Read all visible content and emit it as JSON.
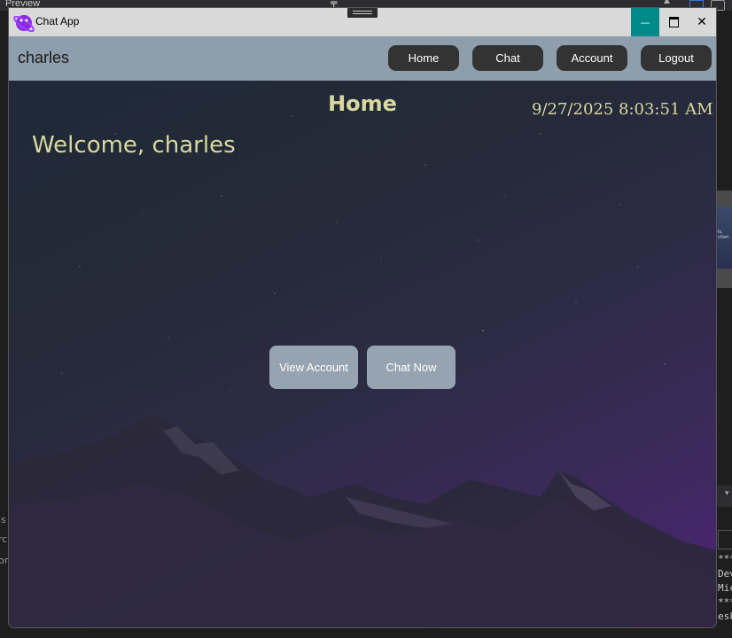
{
  "ide": {
    "preview_label": "Preview",
    "right_lines": [
      "***",
      "Dev",
      "Mic",
      "***",
      "eskt"
    ],
    "left_lines": [
      "ls",
      "rc",
      "on"
    ]
  },
  "window": {
    "title": "Chat App",
    "minimize_glyph": "—",
    "close_glyph": "✕"
  },
  "navbar": {
    "username": "charles",
    "items": [
      {
        "label": "Home"
      },
      {
        "label": "Chat"
      },
      {
        "label": "Account"
      },
      {
        "label": "Logout"
      }
    ]
  },
  "main": {
    "heading": "Home",
    "datetime": "9/27/2025 8:03:51 AM",
    "welcome": "Welcome, charles",
    "buttons": [
      {
        "label": "View Account"
      },
      {
        "label": "Chat Now"
      }
    ]
  },
  "colors": {
    "nav_bg": "#8e9ead",
    "nav_button": "#333333",
    "accent_text": "#d8d8a0",
    "action_button": "#96a4b2",
    "minimize_bg": "#008b8b"
  }
}
